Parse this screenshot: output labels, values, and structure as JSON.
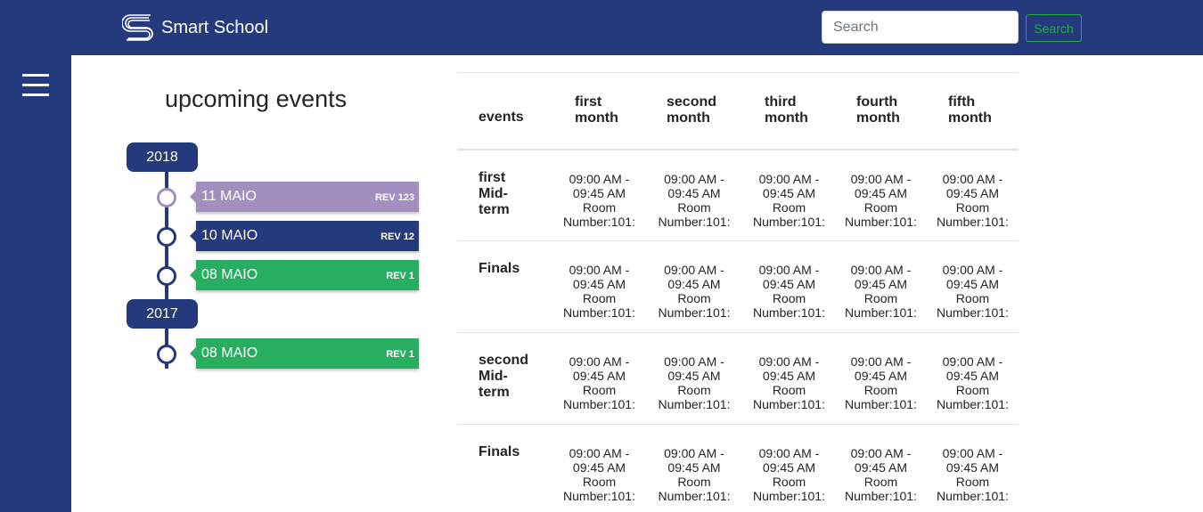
{
  "app": {
    "name": "Smart School"
  },
  "search": {
    "placeholder": "Search",
    "button_label": "Search"
  },
  "page": {
    "title": "upcoming events"
  },
  "timeline": {
    "groups": [
      {
        "year": "2018",
        "entries": [
          {
            "date": "11 MAIO",
            "rev": "REV 123",
            "color": "#a38fbf",
            "dot_border": "#a38fbf"
          },
          {
            "date": "10 MAIO",
            "rev": "REV 12",
            "color": "#243a7d",
            "dot_border": "#243a7d"
          },
          {
            "date": "08 MAIO",
            "rev": "REV 1",
            "color": "#27ae60",
            "dot_border": "#243a7d"
          }
        ]
      },
      {
        "year": "2017",
        "entries": [
          {
            "date": "08 MAIO",
            "rev": "REV 1",
            "color": "#27ae60",
            "dot_border": "#243a7d"
          }
        ]
      }
    ]
  },
  "schedule": {
    "headers": [
      "events",
      "first month",
      "second month",
      "third month",
      "fourth month",
      "fifth month"
    ],
    "rows": [
      {
        "event": "first Mid-term",
        "cells": [
          [
            "09:00 AM -",
            "09:45 AM",
            "Room",
            "Number:101:"
          ],
          [
            "09:00 AM -",
            "09:45 AM",
            "Room",
            "Number:101:"
          ],
          [
            "09:00 AM -",
            "09:45 AM",
            "Room",
            "Number:101:"
          ],
          [
            "09:00 AM -",
            "09:45 AM",
            "Room",
            "Number:101:"
          ],
          [
            "09:00 AM -",
            "09:45 AM",
            "Room",
            "Number:101:"
          ]
        ]
      },
      {
        "event": "Finals",
        "cells": [
          [
            "09:00 AM -",
            "09:45 AM",
            "Room",
            "Number:101:"
          ],
          [
            "09:00 AM -",
            "09:45 AM",
            "Room",
            "Number:101:"
          ],
          [
            "09:00 AM -",
            "09:45 AM",
            "Room",
            "Number:101:"
          ],
          [
            "09:00 AM -",
            "09:45 AM",
            "Room",
            "Number:101:"
          ],
          [
            "09:00 AM -",
            "09:45 AM",
            "Room",
            "Number:101:"
          ]
        ]
      },
      {
        "event": "second Mid-term",
        "cells": [
          [
            "09:00 AM -",
            "09:45 AM",
            "Room",
            "Number:101:"
          ],
          [
            "09:00 AM -",
            "09:45 AM",
            "Room",
            "Number:101:"
          ],
          [
            "09:00 AM -",
            "09:45 AM",
            "Room",
            "Number:101:"
          ],
          [
            "09:00 AM -",
            "09:45 AM",
            "Room",
            "Number:101:"
          ],
          [
            "09:00 AM -",
            "09:45 AM",
            "Room",
            "Number:101:"
          ]
        ]
      },
      {
        "event": "Finals",
        "cells": [
          [
            "09:00 AM -",
            "09:45 AM",
            "Room",
            "Number:101:"
          ],
          [
            "09:00 AM -",
            "09:45 AM",
            "Room",
            "Number:101:"
          ],
          [
            "09:00 AM -",
            "09:45 AM",
            "Room",
            "Number:101:"
          ],
          [
            "09:00 AM -",
            "09:45 AM",
            "Room",
            "Number:101:"
          ],
          [
            "09:00 AM -",
            "09:45 AM",
            "Room",
            "Number:101:"
          ]
        ]
      }
    ]
  },
  "colors": {
    "navbar": "#243a7d",
    "accent_green": "#28a745"
  },
  "icons": {
    "brand": "smart-school-logo-icon",
    "menu": "hamburger-menu-icon"
  }
}
